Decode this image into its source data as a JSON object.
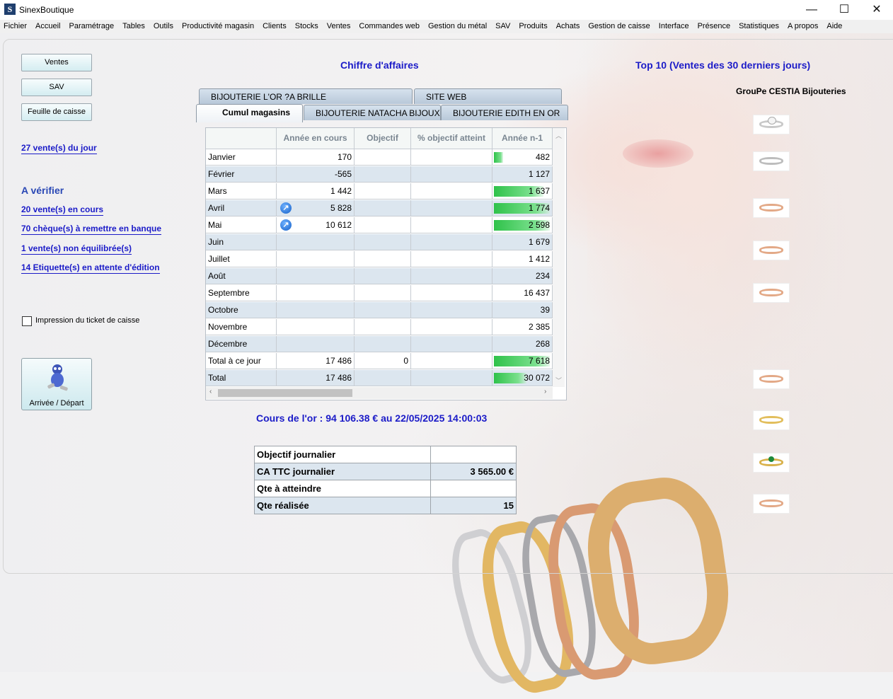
{
  "window": {
    "title": "SinexBoutique",
    "logo": "S",
    "minimize": "—",
    "maximize": "☐",
    "close": "✕"
  },
  "menu": [
    "Fichier",
    "Accueil",
    "Paramétrage",
    "Tables",
    "Outils",
    "Productivité magasin",
    "Clients",
    "Stocks",
    "Ventes",
    "Commandes web",
    "Gestion du métal",
    "SAV",
    "Produits",
    "Achats",
    "Gestion de caisse",
    "Interface",
    "Présence",
    "Statistiques",
    "A propos",
    "Aide"
  ],
  "left": {
    "btn_ventes": "Ventes",
    "btn_sav": "SAV",
    "btn_feuille": "Feuille de caisse",
    "ventes_jour": "27 vente(s) du jour",
    "a_verifier": "A vérifier",
    "links": [
      "20 vente(s) en cours",
      "70 chèque(s) à remettre en banque",
      "1 vente(s) non équilibrée(s)",
      "14 Etiquette(s) en attente d'édition"
    ],
    "checkbox_label": "Impression du ticket de caisse",
    "arrivee_label": "Arrivée / Départ"
  },
  "ca": {
    "title": "Chiffre d'affaires",
    "tabs_back": [
      "BIJOUTERIE L'OR ?A BRILLE",
      "SITE WEB"
    ],
    "tabs_front": [
      "Cumul magasins",
      "BIJOUTERIE NATACHA BIJOUX",
      "BIJOUTERIE EDITH EN OR"
    ],
    "headers": [
      "",
      "Année en cours",
      "Objectif",
      "% objectif atteint",
      "Année n-1"
    ],
    "rows": [
      {
        "label": "Janvier",
        "current": "170",
        "objectif": "",
        "pct": "",
        "prev": "482",
        "bar": 0.16,
        "up": false
      },
      {
        "label": "Février",
        "current": "-565",
        "objectif": "",
        "pct": "",
        "prev": "1 127",
        "bar": 0,
        "up": false
      },
      {
        "label": "Mars",
        "current": "1 442",
        "objectif": "",
        "pct": "",
        "prev": "1 637",
        "bar": 0.88,
        "up": false
      },
      {
        "label": "Avril",
        "current": "5 828",
        "objectif": "",
        "pct": "",
        "prev": "1 774",
        "bar": 1,
        "up": true
      },
      {
        "label": "Mai",
        "current": "10 612",
        "objectif": "",
        "pct": "",
        "prev": "2 598",
        "bar": 1,
        "up": true
      },
      {
        "label": "Juin",
        "current": "",
        "objectif": "",
        "pct": "",
        "prev": "1 679",
        "bar": 0,
        "up": false
      },
      {
        "label": "Juillet",
        "current": "",
        "objectif": "",
        "pct": "",
        "prev": "1 412",
        "bar": 0,
        "up": false
      },
      {
        "label": "Août",
        "current": "",
        "objectif": "",
        "pct": "",
        "prev": "234",
        "bar": 0,
        "up": false
      },
      {
        "label": "Septembre",
        "current": "",
        "objectif": "",
        "pct": "",
        "prev": "16 437",
        "bar": 0,
        "up": false
      },
      {
        "label": "Octobre",
        "current": "",
        "objectif": "",
        "pct": "",
        "prev": "39",
        "bar": 0,
        "up": false
      },
      {
        "label": "Novembre",
        "current": "",
        "objectif": "",
        "pct": "",
        "prev": "2 385",
        "bar": 0,
        "up": false
      },
      {
        "label": "Décembre",
        "current": "",
        "objectif": "",
        "pct": "",
        "prev": "268",
        "bar": 0,
        "up": false
      },
      {
        "label": "Total à ce jour",
        "current": "17 486",
        "objectif": "0",
        "pct": "",
        "prev": "7 618",
        "bar": 1,
        "up": false
      },
      {
        "label": "Total",
        "current": "17 486",
        "objectif": "",
        "pct": "",
        "prev": "30 072",
        "bar": 0.58,
        "up": false
      }
    ]
  },
  "gold_price": "Cours de l'or : 94 106.38 € au 22/05/2025 14:00:03",
  "daily": [
    {
      "label": "Objectif journalier",
      "value": ""
    },
    {
      "label": "CA TTC journalier",
      "value": "3 565.00 €"
    },
    {
      "label": "Qte à atteindre",
      "value": ""
    },
    {
      "label": "Qte réalisée",
      "value": "15"
    }
  ],
  "top10": {
    "title": "Top 10 (Ventes des 30 derniers jours)",
    "group": "GrouPe CESTIA Bijouteries",
    "items": [
      "ring-diamond-icon",
      "ring-chain-icon",
      "ring-rose-gold-icon",
      "ring-rose-gold-icon",
      "ring-rose-gold-icon",
      "ring-rose-gold-icon",
      "ring-gold-icon",
      "ring-emerald-icon",
      "ring-rose-gold-icon"
    ]
  },
  "colors": {
    "link": "#1b1bc8",
    "bar_green": "#2fc24a",
    "row_alt": "#dce6ef"
  }
}
